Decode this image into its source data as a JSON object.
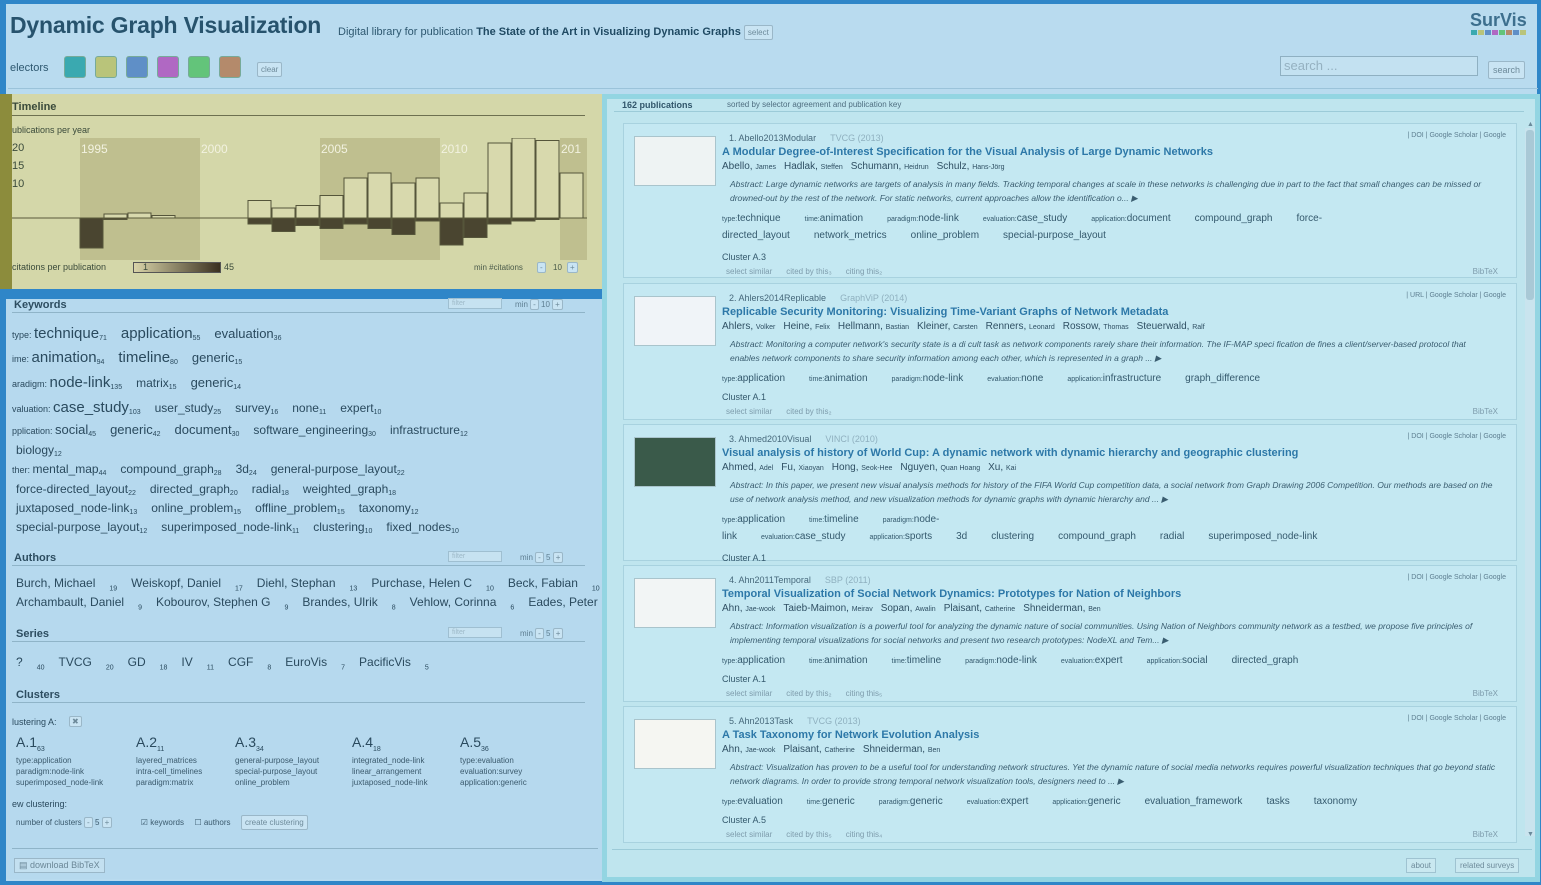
{
  "header": {
    "title": "Dynamic Graph Visualization",
    "subtitle_prefix": "Digital library for publication",
    "subtitle_pub": "The State of the Art in Visualizing Dynamic Graphs",
    "select_label": "select",
    "logo": "SurVis",
    "selectors_label": "electors",
    "clear_label": "clear",
    "search_placeholder": "search ...",
    "search_button": "search",
    "selector_colors": [
      "#3aa9b0",
      "#b9c47a",
      "#5f8fc7",
      "#b068c3",
      "#63c47a",
      "#b48a6b"
    ]
  },
  "timeline": {
    "title": "Timeline",
    "sub": "ublications per year",
    "ylabels": [
      "20",
      "15",
      "10"
    ],
    "decades": [
      "1995",
      "2000",
      "2005",
      "2010",
      "201"
    ],
    "legend_label": "citations per publication",
    "legend_min": "1",
    "legend_max": "45",
    "min_citations_label": "min #citations",
    "min_citations_value": "10"
  },
  "keywords": {
    "title": "Keywords",
    "filter_placeholder": "filter",
    "min_label": "min",
    "min_value": "10",
    "rows": [
      {
        "cat": "type:",
        "items": [
          [
            "technique",
            "71"
          ],
          [
            "application",
            "55"
          ],
          [
            "evaluation",
            "36"
          ]
        ]
      },
      {
        "cat": "ime:",
        "items": [
          [
            "animation",
            "94"
          ],
          [
            "timeline",
            "80"
          ],
          [
            "generic",
            "15"
          ]
        ]
      },
      {
        "cat": "aradigm:",
        "items": [
          [
            "node-link",
            "135"
          ],
          [
            "matrix",
            "15"
          ],
          [
            "generic",
            "14"
          ]
        ]
      },
      {
        "cat": "valuation:",
        "items": [
          [
            "case_study",
            "103"
          ],
          [
            "user_study",
            "25"
          ],
          [
            "survey",
            "16"
          ],
          [
            "none",
            "11"
          ],
          [
            "expert",
            "10"
          ]
        ]
      },
      {
        "cat": "pplication:",
        "items": [
          [
            "social",
            "45"
          ],
          [
            "generic",
            "42"
          ],
          [
            "document",
            "30"
          ],
          [
            "software_engineering",
            "30"
          ],
          [
            "infrastructure",
            "12"
          ]
        ]
      },
      {
        "cat": "",
        "items": [
          [
            "biology",
            "12"
          ]
        ]
      },
      {
        "cat": "ther:",
        "items": [
          [
            "mental_map",
            "44"
          ],
          [
            "compound_graph",
            "28"
          ],
          [
            "3d",
            "24"
          ],
          [
            "general-purpose_layout",
            "22"
          ]
        ]
      },
      {
        "cat": "",
        "items": [
          [
            "force-directed_layout",
            "22"
          ],
          [
            "directed_graph",
            "20"
          ],
          [
            "radial",
            "18"
          ],
          [
            "weighted_graph",
            "18"
          ]
        ]
      },
      {
        "cat": "",
        "items": [
          [
            "juxtaposed_node-link",
            "13"
          ],
          [
            "online_problem",
            "15"
          ],
          [
            "offline_problem",
            "15"
          ],
          [
            "taxonomy",
            "12"
          ]
        ]
      },
      {
        "cat": "",
        "items": [
          [
            "special-purpose_layout",
            "12"
          ],
          [
            "superimposed_node-link",
            "11"
          ],
          [
            "clustering",
            "10"
          ],
          [
            "fixed_nodes",
            "10"
          ]
        ]
      }
    ]
  },
  "authors": {
    "title": "Authors",
    "filter_placeholder": "filter",
    "min_label": "min",
    "min_value": "5",
    "rows": [
      [
        [
          "Burch, Michael",
          "19"
        ],
        [
          "Weiskopf, Daniel",
          "17"
        ],
        [
          "Diehl, Stephan",
          "13"
        ],
        [
          "Purchase, Helen C",
          "10"
        ],
        [
          "Beck, Fabian",
          "10"
        ]
      ],
      [
        [
          "Archambault, Daniel",
          "9"
        ],
        [
          "Kobourov, Stephen G",
          "9"
        ],
        [
          "Brandes, Ulrik",
          "8"
        ],
        [
          "Vehlow, Corinna",
          "6"
        ],
        [
          "Eades, Peter",
          "5"
        ]
      ]
    ]
  },
  "series": {
    "title": "Series",
    "filter_placeholder": "filter",
    "min_label": "min",
    "min_value": "5",
    "items": [
      [
        "?",
        "40"
      ],
      [
        "TVCG",
        "20"
      ],
      [
        "GD",
        "18"
      ],
      [
        "IV",
        "11"
      ],
      [
        "CGF",
        "8"
      ],
      [
        "EuroVis",
        "7"
      ],
      [
        "PacificVis",
        "5"
      ]
    ]
  },
  "clusters": {
    "title": "Clusters",
    "clustering_label": "lustering A:",
    "items": [
      {
        "name": "A.1",
        "count": "63",
        "lines": [
          "type:application",
          "paradigm:node-link",
          "superimposed_node-link"
        ]
      },
      {
        "name": "A.2",
        "count": "11",
        "lines": [
          "layered_matrices",
          "intra-cell_timelines",
          "paradigm:matrix"
        ]
      },
      {
        "name": "A.3",
        "count": "34",
        "lines": [
          "general-purpose_layout",
          "special-purpose_layout",
          "online_problem"
        ]
      },
      {
        "name": "A.4",
        "count": "18",
        "lines": [
          "integrated_node-link",
          "linear_arrangement",
          "juxtaposed_node-link"
        ]
      },
      {
        "name": "A.5",
        "count": "36",
        "lines": [
          "type:evaluation",
          "evaluation:survey",
          "application:generic"
        ]
      }
    ],
    "new_clustering_label": "ew clustering:",
    "num_clusters_label": "number of clusters",
    "num_clusters_value": "5",
    "keywords_label": "keywords",
    "authors_label": "authors",
    "create_label": "create clustering"
  },
  "download_label": "download BibTeX",
  "publications": {
    "count": "162 publications",
    "sort": "sorted by selector agreement and publication key",
    "entries": [
      {
        "id": "1. Abello2013Modular",
        "venue": "TVCG (2013)",
        "links": "| DOI | Google Scholar | Google",
        "title": "A Modular Degree-of-Interest Specification for the Visual Analysis of Large Dynamic Networks",
        "authors": [
          [
            "Abello,",
            "James"
          ],
          [
            "Hadlak,",
            "Steffen"
          ],
          [
            "Schumann,",
            "Heidrun"
          ],
          [
            "Schulz,",
            "Hans-Jörg"
          ]
        ],
        "abstract": "Abstract: Large dynamic networks are targets of analysis in many fields. Tracking temporal changes at scale in these networks is challenging due in part to the fact that small changes can be missed or drowned-out by the rest of the network. For static networks, current approaches allow the identification o... ▶",
        "tags": [
          [
            "type:",
            "technique"
          ],
          [
            "time:",
            "animation"
          ],
          [
            "paradigm:",
            "node-link"
          ],
          [
            "evaluation:",
            "case_study"
          ],
          [
            "application:",
            "document"
          ],
          [
            "",
            "compound_graph"
          ],
          [
            "",
            "force-directed_layout"
          ],
          [
            "",
            "network_metrics"
          ],
          [
            "",
            "online_problem"
          ],
          [
            "",
            "special-purpose_layout"
          ]
        ],
        "cluster": "Cluster  A.3",
        "foot": [
          "select similar",
          "cited by this₃",
          "citing this₂"
        ],
        "bib": "BibTeX"
      },
      {
        "id": "2. Ahlers2014Replicable",
        "venue": "GraphViP (2014)",
        "links": "| URL | Google Scholar | Google",
        "title": "Replicable Security Monitoring: Visualizing Time-Variant Graphs of Network Metadata",
        "authors": [
          [
            "Ahlers,",
            "Volker"
          ],
          [
            "Heine,",
            "Felix"
          ],
          [
            "Hellmann,",
            "Bastian"
          ],
          [
            "Kleiner,",
            "Carsten"
          ],
          [
            "Renners,",
            "Leonard"
          ],
          [
            "Rossow,",
            "Thomas"
          ],
          [
            "Steuerwald,",
            "Ralf"
          ]
        ],
        "abstract": "Abstract: Monitoring a computer network's security state is a di cult task as network components rarely share their information. The IF-MAP speci fication de fines a client/server-based protocol that enables network components to share security information among each other, which is represented in a graph ... ▶",
        "tags": [
          [
            "type:",
            "application"
          ],
          [
            "time:",
            "animation"
          ],
          [
            "paradigm:",
            "node-link"
          ],
          [
            "evaluation:",
            "none"
          ],
          [
            "application:",
            "infrastructure"
          ],
          [
            "",
            "graph_difference"
          ]
        ],
        "cluster": "Cluster  A.1",
        "foot": [
          "select similar",
          "cited by this₂"
        ],
        "bib": "BibTeX"
      },
      {
        "id": "3. Ahmed2010Visual",
        "venue": "VINCI (2010)",
        "links": "| DOI | Google Scholar | Google",
        "title": "Visual analysis of history of World Cup: A dynamic network with dynamic hierarchy and geographic clustering",
        "authors": [
          [
            "Ahmed,",
            "Adel"
          ],
          [
            "Fu,",
            "Xiaoyan"
          ],
          [
            "Hong,",
            "Seok-Hee"
          ],
          [
            "Nguyen,",
            "Quan Hoang"
          ],
          [
            "Xu,",
            "Kai"
          ]
        ],
        "abstract": "Abstract: In this paper, we present new visual analysis methods for history of the FIFA World Cup competition data, a social network from Graph Drawing 2006 Competition. Our methods are based on the use of network analysis method, and new visualization methods for dynamic graphs with dynamic hierarchy and ... ▶",
        "tags": [
          [
            "type:",
            "application"
          ],
          [
            "time:",
            "timeline"
          ],
          [
            "paradigm:",
            "node-link"
          ],
          [
            "evaluation:",
            "case_study"
          ],
          [
            "application:",
            "sports"
          ],
          [
            "",
            "3d"
          ],
          [
            "",
            "clustering"
          ],
          [
            "",
            "compound_graph"
          ],
          [
            "",
            "radial"
          ],
          [
            "",
            "superimposed_node-link"
          ]
        ],
        "cluster": "Cluster  A.1",
        "foot": [
          "select similar",
          "cited by this₅",
          "citing this₂"
        ],
        "bib": "BibTeX"
      },
      {
        "id": "4. Ahn2011Temporal",
        "venue": "SBP (2011)",
        "links": "| DOI | Google Scholar | Google",
        "title": "Temporal Visualization of Social Network Dynamics: Prototypes for Nation of Neighbors",
        "authors": [
          [
            "Ahn,",
            "Jae-wook"
          ],
          [
            "Taieb-Maimon,",
            "Meirav"
          ],
          [
            "Sopan,",
            "Awalin"
          ],
          [
            "Plaisant,",
            "Catherine"
          ],
          [
            "Shneiderman,",
            "Ben"
          ]
        ],
        "abstract": "Abstract: Information visualization is a powerful tool for analyzing the dynamic nature of social communities. Using Nation of Neighbors community network as a testbed, we propose five principles of implementing temporal visualizations for social networks and present two research prototypes: NodeXL and Tem... ▶",
        "tags": [
          [
            "type:",
            "application"
          ],
          [
            "time:",
            "animation"
          ],
          [
            "time:",
            "timeline"
          ],
          [
            "paradigm:",
            "node-link"
          ],
          [
            "evaluation:",
            "expert"
          ],
          [
            "application:",
            "social"
          ],
          [
            "",
            "directed_graph"
          ]
        ],
        "cluster": "Cluster  A.1",
        "foot": [
          "select similar",
          "cited by this₂",
          "citing this₅"
        ],
        "bib": "BibTeX"
      },
      {
        "id": "5. Ahn2013Task",
        "venue": "TVCG (2013)",
        "links": "| DOI | Google Scholar | Google",
        "title": "A Task Taxonomy for Network Evolution Analysis",
        "authors": [
          [
            "Ahn,",
            "Jae-wook"
          ],
          [
            "Plaisant,",
            "Catherine"
          ],
          [
            "Shneiderman,",
            "Ben"
          ]
        ],
        "abstract": "Abstract: Visualization has proven to be a useful tool for understanding network structures. Yet the dynamic nature of social media networks requires powerful visualization techniques that go beyond static network diagrams. In order to provide strong temporal network visualization tools, designers need to ... ▶",
        "tags": [
          [
            "type:",
            "evaluation"
          ],
          [
            "time:",
            "generic"
          ],
          [
            "paradigm:",
            "generic"
          ],
          [
            "evaluation:",
            "expert"
          ],
          [
            "application:",
            "generic"
          ],
          [
            "",
            "evaluation_framework"
          ],
          [
            "",
            "tasks"
          ],
          [
            "",
            "taxonomy"
          ]
        ],
        "cluster": "Cluster  A.5",
        "foot": [
          "select similar",
          "cited by this₅",
          "citing this₄"
        ],
        "bib": "BibTeX"
      }
    ]
  },
  "footer": {
    "about": "about",
    "related": "related surveys"
  }
}
